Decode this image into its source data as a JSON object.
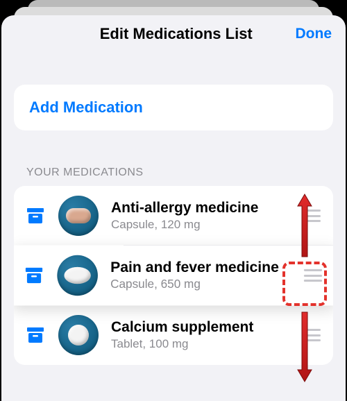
{
  "nav": {
    "title": "Edit Medications List",
    "done": "Done"
  },
  "addButton": {
    "label": "Add Medication"
  },
  "section": {
    "header": "YOUR MEDICATIONS"
  },
  "medications": [
    {
      "name": "Anti-allergy medicine",
      "subtitle": "Capsule, 120 mg",
      "pill": "capsule"
    },
    {
      "name": "Pain and fever medicine",
      "subtitle": "Capsule, 650 mg",
      "pill": "oval"
    },
    {
      "name": "Calcium supplement",
      "subtitle": "Tablet, 100 mg",
      "pill": "round"
    }
  ],
  "colors": {
    "accent": "#007aff"
  }
}
